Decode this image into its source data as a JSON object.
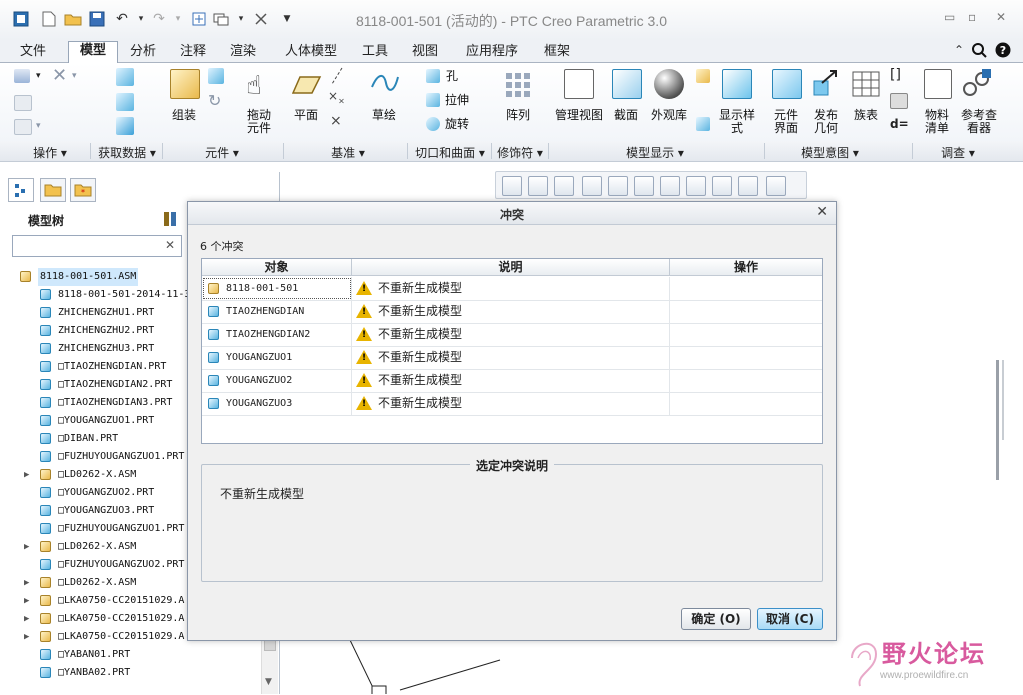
{
  "window": {
    "title": "8118-001-501 (活动的) - PTC Creo Parametric 3.0"
  },
  "tabs": [
    "文件",
    "模型",
    "分析",
    "注释",
    "渲染",
    "人体模型",
    "工具",
    "视图",
    "应用程序",
    "框架"
  ],
  "ribbon": {
    "buttons": {
      "assemble": "组装",
      "drag": "拖动\n元件",
      "plane": "平面",
      "sketch": "草绘",
      "hole": "孔",
      "extrude": "拉伸",
      "revolve": "旋转",
      "pattern": "阵列",
      "manage_views": "管理视图",
      "section": "截面",
      "appearance": "外观库",
      "display_style": "显示样\n式",
      "component_interface": "元件\n界面",
      "publish_geometry": "发布\n几何",
      "family_table": "族表",
      "bom": "物料\n清单",
      "ref_viewer": "参考查\n看器"
    },
    "groups": [
      "操作",
      "获取数据",
      "元件",
      "基准",
      "切口和曲面",
      "修饰符",
      "模型显示",
      "模型意图",
      "调查"
    ]
  },
  "left_panel": {
    "title": "模型树",
    "search_value": "",
    "tree": [
      {
        "name": "8118-001-501.ASM",
        "type": "asm",
        "expand": "",
        "indent": 0,
        "selected": true
      },
      {
        "name": "8118-001-501-2014-11-3",
        "type": "prt",
        "expand": "",
        "indent": 1
      },
      {
        "name": "ZHICHENGZHU1.PRT",
        "type": "prt",
        "expand": "",
        "indent": 1
      },
      {
        "name": "ZHICHENGZHU2.PRT",
        "type": "prt",
        "expand": "",
        "indent": 1
      },
      {
        "name": "ZHICHENGZHU3.PRT",
        "type": "prt",
        "expand": "",
        "indent": 1
      },
      {
        "name": "□TIAOZHENGDIAN.PRT",
        "type": "prt",
        "expand": "",
        "indent": 1
      },
      {
        "name": "□TIAOZHENGDIAN2.PRT",
        "type": "prt",
        "expand": "",
        "indent": 1
      },
      {
        "name": "□TIAOZHENGDIAN3.PRT",
        "type": "prt",
        "expand": "",
        "indent": 1
      },
      {
        "name": "□YOUGANGZUO1.PRT",
        "type": "prt",
        "expand": "",
        "indent": 1
      },
      {
        "name": "□DIBAN.PRT",
        "type": "prt",
        "expand": "",
        "indent": 1
      },
      {
        "name": "□FUZHUYOUGANGZUO1.PRT",
        "type": "prt",
        "expand": "",
        "indent": 1
      },
      {
        "name": "□LD0262-X.ASM",
        "type": "asm",
        "expand": "▶",
        "indent": 1
      },
      {
        "name": "□YOUGANGZUO2.PRT",
        "type": "prt",
        "expand": "",
        "indent": 1
      },
      {
        "name": "□YOUGANGZUO3.PRT",
        "type": "prt",
        "expand": "",
        "indent": 1
      },
      {
        "name": "□FUZHUYOUGANGZUO1.PRT",
        "type": "prt",
        "expand": "",
        "indent": 1
      },
      {
        "name": "□LD0262-X.ASM",
        "type": "asm",
        "expand": "▶",
        "indent": 1
      },
      {
        "name": "□FUZHUYOUGANGZUO2.PRT",
        "type": "prt",
        "expand": "",
        "indent": 1
      },
      {
        "name": "□LD0262-X.ASM",
        "type": "asm",
        "expand": "▶",
        "indent": 1
      },
      {
        "name": "□LKA0750-CC20151029.A",
        "type": "asm",
        "expand": "▶",
        "indent": 1
      },
      {
        "name": "□LKA0750-CC20151029.A",
        "type": "asm",
        "expand": "▶",
        "indent": 1
      },
      {
        "name": "□LKA0750-CC20151029.A",
        "type": "asm",
        "expand": "▶",
        "indent": 1
      },
      {
        "name": "□YABAN01.PRT",
        "type": "prt",
        "expand": "",
        "indent": 1
      },
      {
        "name": "□YANBA02.PRT",
        "type": "prt",
        "expand": "",
        "indent": 1
      }
    ]
  },
  "dialog": {
    "title": "冲突",
    "conflict_count": "6 个冲突",
    "columns": [
      "对象",
      "说明",
      "操作"
    ],
    "rows": [
      {
        "object": "8118-001-501",
        "type": "asm",
        "description": "不重新生成模型",
        "action": ""
      },
      {
        "object": "TIAOZHENGDIAN",
        "type": "prt",
        "description": "不重新生成模型",
        "action": ""
      },
      {
        "object": "TIAOZHENGDIAN2",
        "type": "prt",
        "description": "不重新生成模型",
        "action": ""
      },
      {
        "object": "YOUGANGZUO1",
        "type": "prt",
        "description": "不重新生成模型",
        "action": ""
      },
      {
        "object": "YOUGANGZUO2",
        "type": "prt",
        "description": "不重新生成模型",
        "action": ""
      },
      {
        "object": "YOUGANGZUO3",
        "type": "prt",
        "description": "不重新生成模型",
        "action": ""
      }
    ],
    "selected_desc_title": "选定冲突说明",
    "selected_desc_text": "不重新生成模型",
    "ok_label": "确定 (O)",
    "cancel_label": "取消 (C)"
  },
  "watermark": {
    "text": "野火论坛",
    "url": "www.proewildfire.cn"
  },
  "colors": {
    "accent": "#3c8fc8",
    "warning": "#e8b400",
    "watermark": "#d85a9e"
  }
}
